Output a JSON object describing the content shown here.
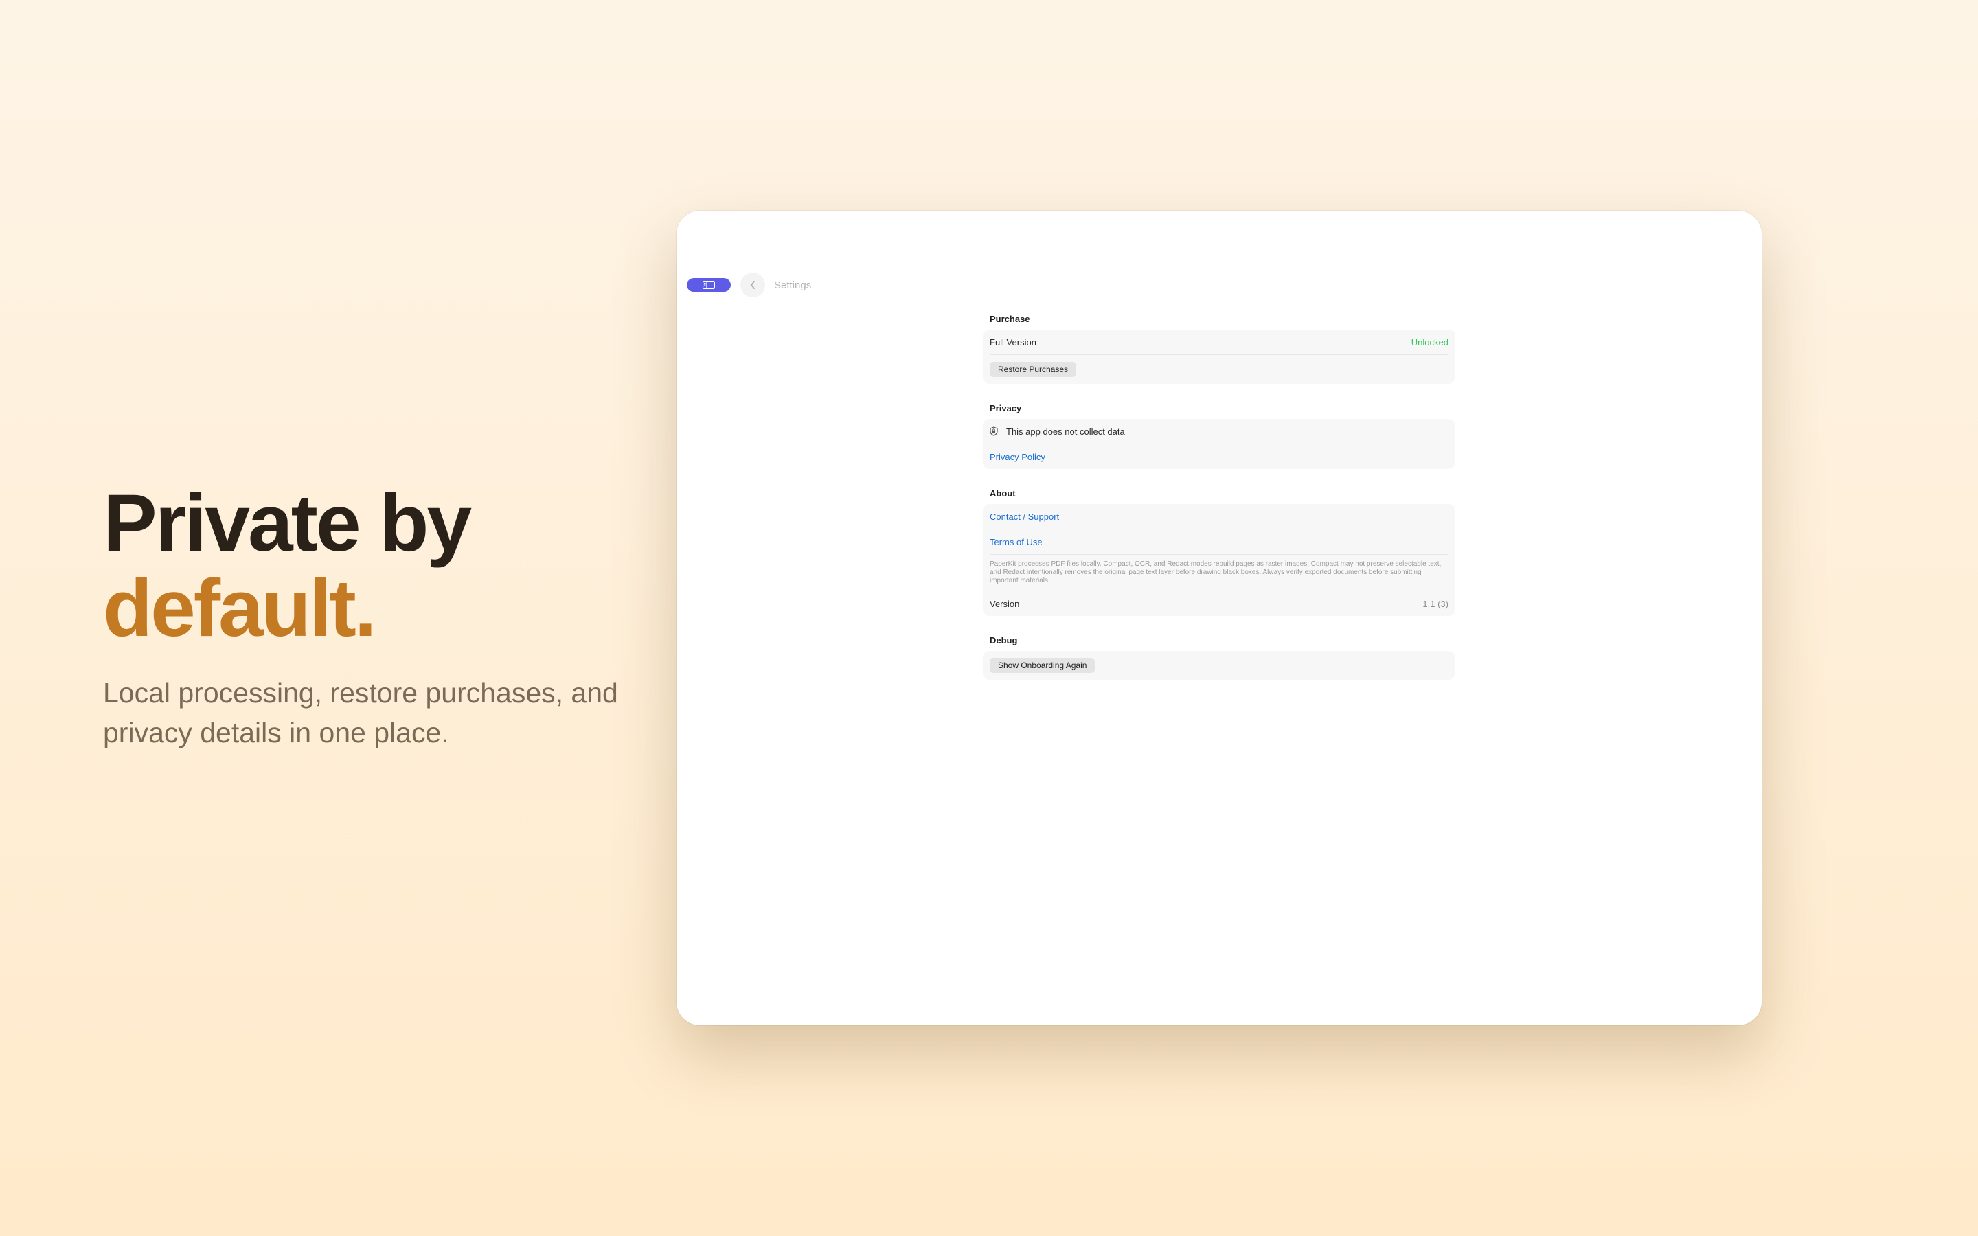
{
  "marketing": {
    "headline_line1": "Private by",
    "headline_line2": "default.",
    "subtitle": "Local processing, restore purchases, and privacy details in one place."
  },
  "toolbar": {
    "title": "Settings",
    "icons": [
      "sidebar-icon",
      "chevron-left-icon"
    ]
  },
  "sections": {
    "purchase": {
      "header": "Purchase",
      "full_version_label": "Full Version",
      "full_version_status": "Unlocked",
      "restore_button": "Restore Purchases"
    },
    "privacy": {
      "header": "Privacy",
      "data_statement": "This app does not collect data",
      "policy_link": "Privacy Policy"
    },
    "about": {
      "header": "About",
      "contact_link": "Contact / Support",
      "terms_link": "Terms of Use",
      "disclaimer": "PaperKit processes PDF files locally. Compact, OCR, and Redact modes rebuild pages as raster images; Compact may not preserve selectable text, and Redact intentionally removes the original page text layer before drawing black boxes. Always verify exported documents before submitting important materials.",
      "version_label": "Version",
      "version_value": "1.1 (3)"
    },
    "debug": {
      "header": "Debug",
      "onboarding_button": "Show Onboarding Again"
    }
  },
  "colors": {
    "accent": "#c47a22",
    "sidebar_toggle": "#5e5ce6",
    "status_green": "#34c759",
    "link_blue": "#1a6fd1"
  }
}
